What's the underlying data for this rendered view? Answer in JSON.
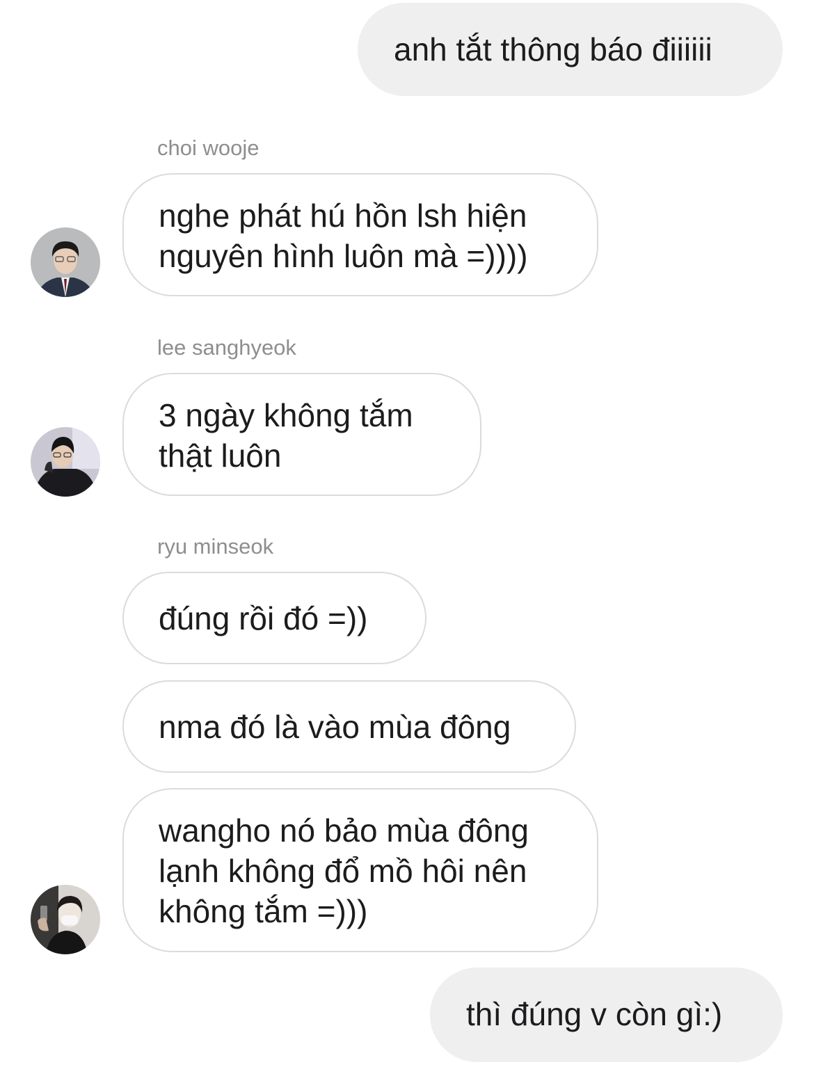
{
  "messages": [
    {
      "direction": "outgoing",
      "text": "anh tắt thông báo điiiiii"
    },
    {
      "direction": "incoming",
      "sender": "choi wooje",
      "text": "nghe phát hú hồn lsh hiện\nnguyên hình luôn mà =))))"
    },
    {
      "direction": "incoming",
      "sender": "lee sanghyeok",
      "text": "3 ngày không tắm\nthật luôn"
    },
    {
      "direction": "incoming",
      "sender": "ryu minseok",
      "text": "đúng rồi đó =))"
    },
    {
      "direction": "incoming",
      "text": "nma đó là vào mùa đông"
    },
    {
      "direction": "incoming",
      "text": "wangho nó bảo mùa đông\nlạnh không đổ mồ hôi nên\nkhông tắm =)))"
    },
    {
      "direction": "outgoing",
      "text": "thì đúng v còn gì:)"
    }
  ],
  "avatars": [
    {
      "icon": "avatar-photo",
      "owner": "choi wooje"
    },
    {
      "icon": "avatar-photo",
      "owner": "lee sanghyeok"
    },
    {
      "icon": "avatar-photo",
      "owner": "ryu minseok"
    }
  ],
  "colors": {
    "outgoing_bubble": "#efefef",
    "incoming_border": "#dbdbdb",
    "sender_name": "#8e8e8e",
    "text": "#1c1c1e"
  }
}
